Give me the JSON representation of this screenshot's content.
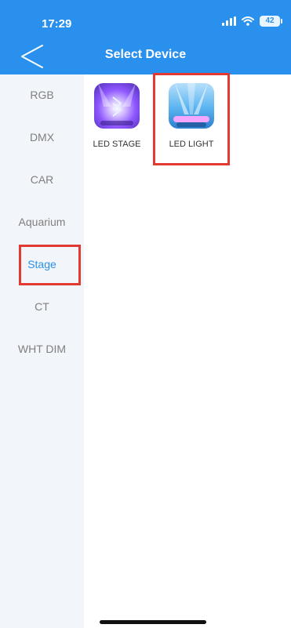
{
  "status_bar": {
    "time": "17:29",
    "battery": "42"
  },
  "nav": {
    "title": "Select Device",
    "back_icon": "chevron-left-icon"
  },
  "sidebar": {
    "items": [
      {
        "label": "RGB"
      },
      {
        "label": "DMX"
      },
      {
        "label": "CAR"
      },
      {
        "label": "Aquarium"
      },
      {
        "label": "Stage",
        "selected": true
      },
      {
        "label": "CT"
      },
      {
        "label": "WHT DIM"
      }
    ]
  },
  "devices": [
    {
      "label": "LED STAGE",
      "icon": "led-stage-bluetooth-icon"
    },
    {
      "label": "LED LIGHT",
      "icon": "led-light-icon"
    }
  ],
  "colors": {
    "accent": "#2a90ee",
    "sidebar_bg": "#f2f5f9",
    "highlight": "#e23a32"
  }
}
